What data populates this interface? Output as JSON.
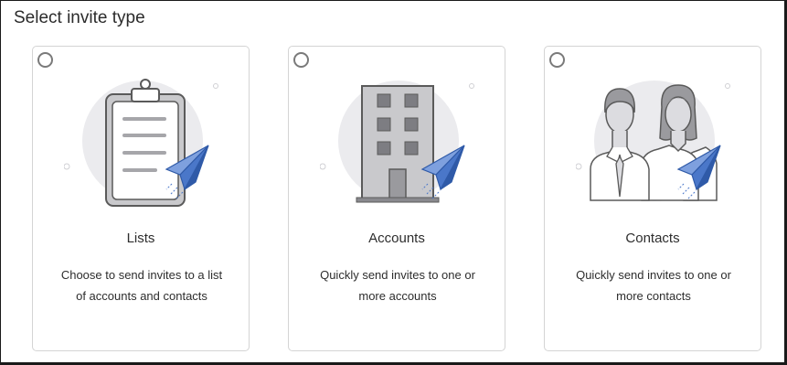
{
  "page": {
    "title": "Select invite type"
  },
  "cards": [
    {
      "id": "lists",
      "title": "Lists",
      "description": "Choose to send invites to a list of accounts and contacts",
      "selected": false,
      "icon": "clipboard-icon"
    },
    {
      "id": "accounts",
      "title": "Accounts",
      "description": "Quickly send invites to one or more accounts",
      "selected": false,
      "icon": "building-icon"
    },
    {
      "id": "contacts",
      "title": "Contacts",
      "description": "Quickly send invites to one or more contacts",
      "selected": false,
      "icon": "people-icon"
    }
  ],
  "colors": {
    "plane_blue": "#4a77c9",
    "blob_gray": "#ebebee",
    "line_gray": "#5a5a5a"
  }
}
